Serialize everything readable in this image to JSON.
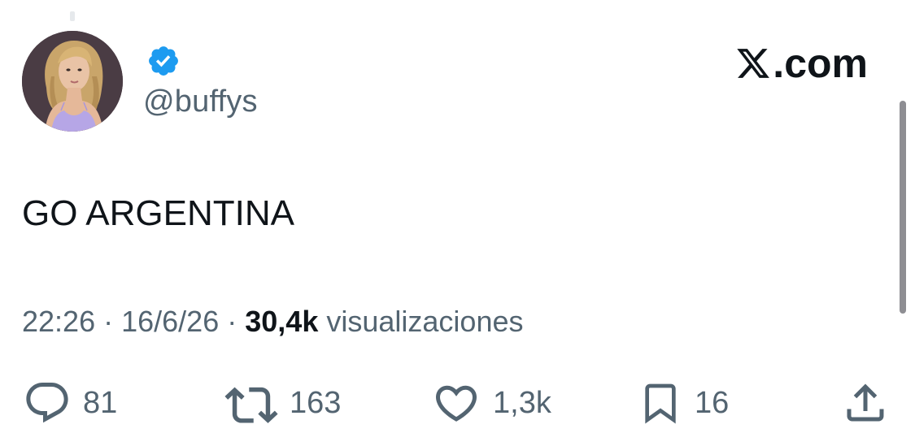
{
  "author": {
    "handle": "@buffys",
    "verified": true,
    "avatar_icon": "profile-photo"
  },
  "brand": {
    "label": ".com",
    "logo_icon": "x-logo-icon"
  },
  "tweet": {
    "text": "GO ARGENTINA",
    "time": "22:26",
    "date": "16/6/26",
    "views_count": "30,4k",
    "views_label": "visualizaciones"
  },
  "actions": {
    "reply": {
      "icon": "reply-icon",
      "count": "81"
    },
    "retweet": {
      "icon": "retweet-icon",
      "count": "163"
    },
    "like": {
      "icon": "heart-icon",
      "count": "1,3k"
    },
    "bookmark": {
      "icon": "bookmark-icon",
      "count": "16"
    },
    "share": {
      "icon": "share-icon"
    }
  },
  "colors": {
    "text_primary": "#0f1419",
    "text_secondary": "#536471",
    "verified_blue": "#1d9bf0",
    "background": "#ffffff"
  }
}
